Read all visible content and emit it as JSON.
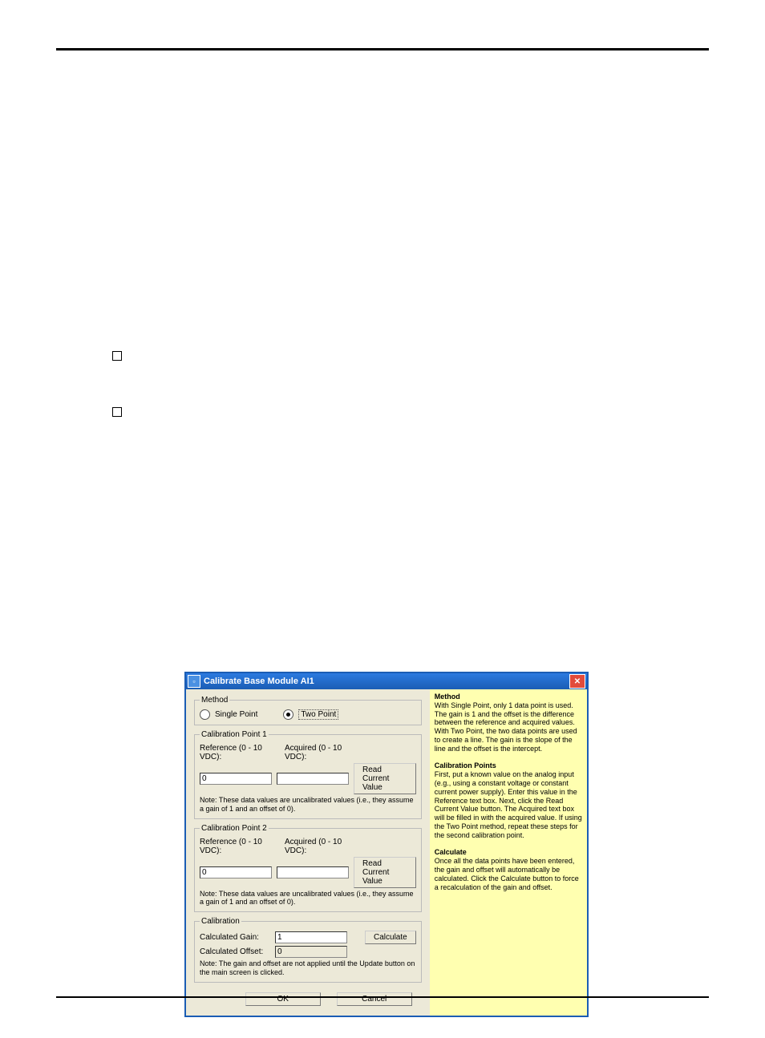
{
  "titlebar": {
    "title": "Calibrate Base Module AI1"
  },
  "method": {
    "legend": "Method",
    "single": "Single Point",
    "two": "Two Point"
  },
  "cp1": {
    "legend": "Calibration Point 1",
    "ref_label": "Reference (0 - 10 VDC):",
    "acq_label": "Acquired (0 - 10 VDC):",
    "ref_value": "0",
    "acq_value": "",
    "read_btn": "Read Current Value",
    "note": "Note: These data values are uncalibrated values (i.e., they assume a gain of 1 and an offset of 0)."
  },
  "cp2": {
    "legend": "Calibration Point 2",
    "ref_label": "Reference (0 - 10 VDC):",
    "acq_label": "Acquired (0 - 10 VDC):",
    "ref_value": "0",
    "acq_value": "",
    "read_btn": "Read Current Value",
    "note": "Note: These data values are uncalibrated values (i.e., they assume a gain of 1 and an offset of 0)."
  },
  "calib": {
    "legend": "Calibration",
    "gain_label": "Calculated Gain:",
    "offset_label": "Calculated Offset:",
    "gain_value": "1",
    "offset_value": "0",
    "calc_btn": "Calculate",
    "note": "Note: The gain and offset are not applied until the Update button on the main screen is clicked."
  },
  "buttons": {
    "ok": "OK",
    "cancel": "Cancel"
  },
  "help": {
    "h1": "Method",
    "p1": "With Single Point, only 1 data point is used. The gain is 1 and the offset is the difference between the reference and acquired values. With Two Point, the two data points are used to create a line. The gain is the slope of the line and the offset is the intercept.",
    "h2": "Calibration Points",
    "p2": "First, put a known value on the analog input (e.g., using a constant voltage or constant current power supply). Enter this value in the Reference text box. Next, click the Read Current Value button. The Acquired text box will be filled in with the acquired value. If using the Two Point method, repeat these steps for the second calibration point.",
    "h3": "Calculate",
    "p3": "Once all the data points have been entered, the gain and offset will automatically be calculated. Click the Calculate button to force a recalculation of the gain and offset."
  }
}
